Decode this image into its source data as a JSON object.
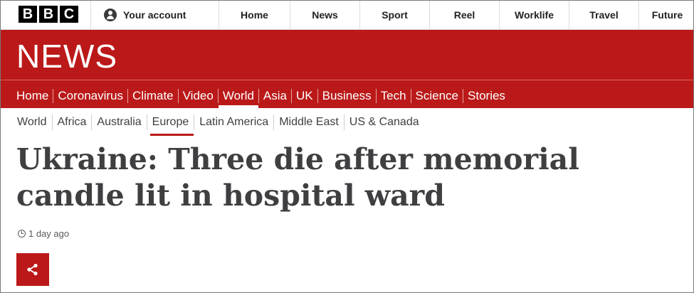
{
  "topbar": {
    "logo": [
      "B",
      "B",
      "C"
    ],
    "account_label": "Your account",
    "nav": [
      {
        "label": "Home",
        "width": 100
      },
      {
        "label": "News",
        "width": 98
      },
      {
        "label": "Sport",
        "width": 98
      },
      {
        "label": "Reel",
        "width": 98
      },
      {
        "label": "Worklife",
        "width": 98
      },
      {
        "label": "Travel",
        "width": 98
      },
      {
        "label": "Future",
        "width": 80
      }
    ]
  },
  "banner": {
    "wordmark": "NEWS",
    "nav": [
      "Home",
      "Coronavirus",
      "Climate",
      "Video",
      "World",
      "Asia",
      "UK",
      "Business",
      "Tech",
      "Science",
      "Stories"
    ],
    "active": "World"
  },
  "subnav": {
    "items": [
      "World",
      "Africa",
      "Australia",
      "Europe",
      "Latin America",
      "Middle East",
      "US & Canada"
    ],
    "active": "Europe"
  },
  "article": {
    "headline": "Ukraine: Three die after memorial candle lit in hospital ward",
    "timestamp": "1 day ago"
  },
  "colors": {
    "brand_red": "#bb1919",
    "headline": "#3f3f42"
  },
  "icons": {
    "share": "share-icon",
    "clock": "clock-icon",
    "account": "account-icon"
  }
}
